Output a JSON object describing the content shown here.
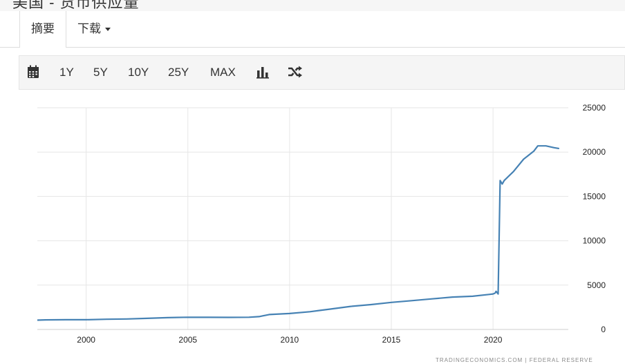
{
  "header": {
    "title_partial": "美国 - 货币供应量"
  },
  "tabs": [
    {
      "label": "摘要",
      "active": true
    },
    {
      "label": "下载",
      "dropdown": true
    }
  ],
  "toolbar": {
    "items": [
      {
        "name": "calendar-icon",
        "icon": true
      },
      {
        "label": "1Y"
      },
      {
        "label": "5Y"
      },
      {
        "label": "10Y"
      },
      {
        "label": "25Y"
      },
      {
        "label": "MAX"
      },
      {
        "name": "bar-chart-icon",
        "icon": true
      },
      {
        "name": "shuffle-icon",
        "icon": true
      }
    ]
  },
  "colors": {
    "line": "#4682b4",
    "grid": "#e6e6e6",
    "toolbar_bg": "#f5f5f5"
  },
  "chart_data": {
    "type": "line",
    "title": "",
    "xlabel": "",
    "ylabel": "",
    "x_ticks": [
      2000,
      2005,
      2010,
      2015,
      2020
    ],
    "y_ticks": [
      0,
      5000,
      10000,
      15000,
      20000,
      25000
    ],
    "xlim": [
      1997.6,
      2023.7
    ],
    "ylim": [
      0,
      25000
    ],
    "grid": true,
    "y_axis_position": "right",
    "series": [
      {
        "x": [
          1997.6,
          1998.0,
          1999.0,
          2000.0,
          2001.0,
          2002.0,
          2003.0,
          2004.0,
          2005.0,
          2006.0,
          2007.0,
          2008.0,
          2008.5,
          2009.0,
          2010.0,
          2011.0,
          2011.5,
          2012.0,
          2013.0,
          2014.0,
          2015.0,
          2016.0,
          2017.0,
          2018.0,
          2019.0,
          2019.8,
          2020.0,
          2020.1,
          2020.15,
          2020.25,
          2020.35,
          2020.45,
          2020.55,
          2021.0,
          2021.5,
          2022.0,
          2022.2,
          2022.6,
          2023.0,
          2023.25
        ],
        "values": [
          1050,
          1080,
          1100,
          1100,
          1150,
          1180,
          1250,
          1330,
          1380,
          1370,
          1360,
          1380,
          1450,
          1680,
          1800,
          2000,
          2150,
          2300,
          2600,
          2800,
          3050,
          3250,
          3450,
          3650,
          3750,
          3950,
          4000,
          4100,
          4300,
          4000,
          16800,
          16400,
          16800,
          17800,
          19200,
          20100,
          20700,
          20700,
          20500,
          20400
        ]
      }
    ]
  },
  "footer": {
    "source_partial": "TRADINGECONOMICS.COM | FEDERAL RESERVE"
  }
}
